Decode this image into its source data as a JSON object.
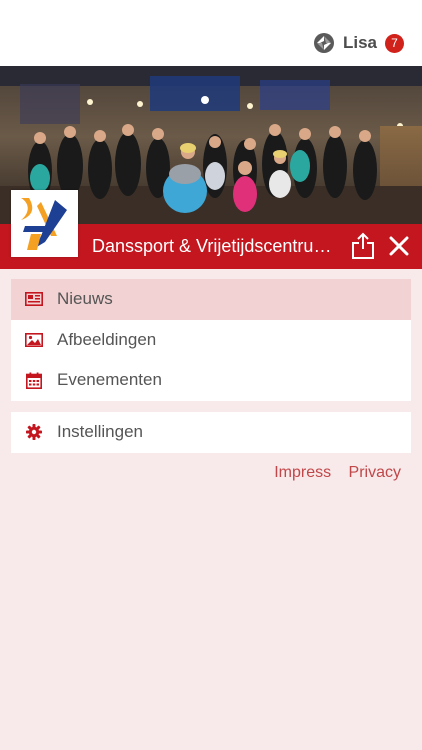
{
  "header": {
    "user_name": "Lisa",
    "notification_count": "7"
  },
  "club": {
    "name": "Danssport & Vrijetijdscentrum Ardos"
  },
  "menu": {
    "items": [
      {
        "label": "Nieuws",
        "icon": "newspaper-icon",
        "active": true
      },
      {
        "label": "Afbeeldingen",
        "icon": "image-icon",
        "active": false
      },
      {
        "label": "Evenementen",
        "icon": "calendar-icon",
        "active": false
      }
    ]
  },
  "settings": {
    "label": "Instellingen",
    "icon": "gear-icon"
  },
  "footer": {
    "impress": "Impress",
    "privacy": "Privacy"
  },
  "colors": {
    "accent": "#c3161f",
    "background": "#f8eaea",
    "active_row": "#f2d2d2",
    "link": "#c0474a"
  }
}
